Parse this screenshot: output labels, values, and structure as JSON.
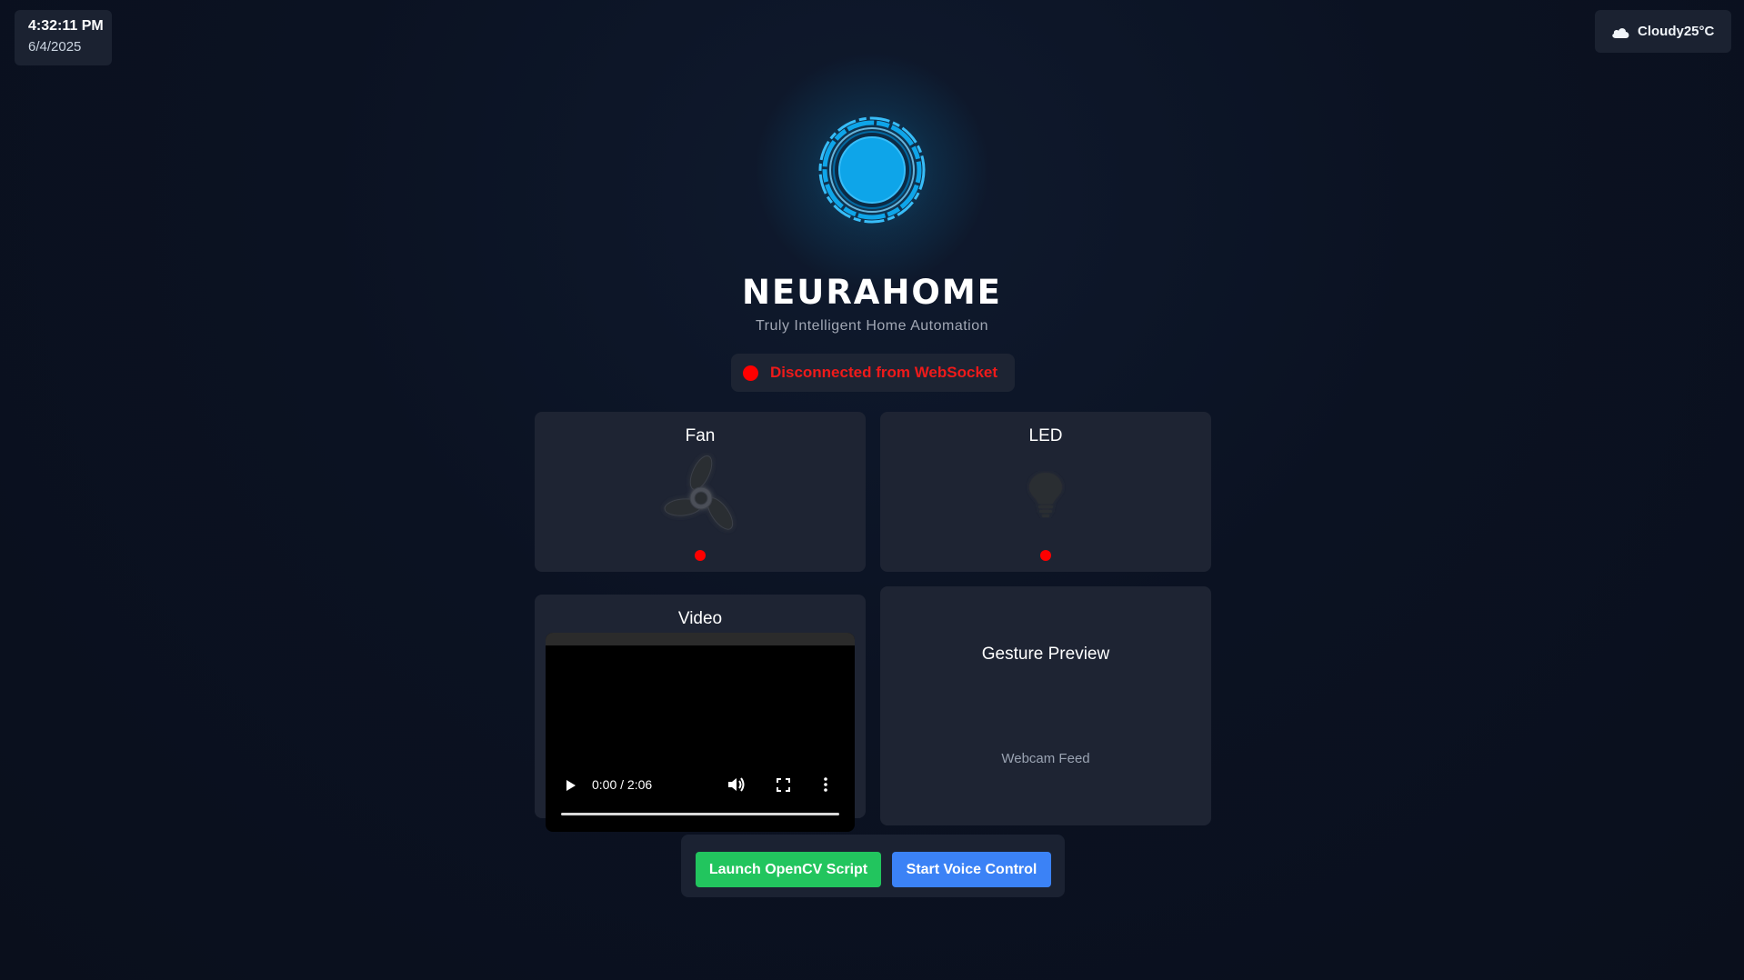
{
  "clock": {
    "time": "4:32:11 PM",
    "date": "6/4/2025"
  },
  "weather": {
    "condition": "Cloudy",
    "temperature": "25°C",
    "icon": "cloud-icon"
  },
  "hero": {
    "icon": "neural-orb-icon",
    "brand": "NEURAHOME",
    "tagline": "Truly Intelligent Home Automation"
  },
  "connection": {
    "status_text": "Disconnected from WebSocket",
    "status_color": "#ff0000"
  },
  "devices": [
    {
      "label": "Fan",
      "icon": "fan-icon",
      "state": "off",
      "indicator_color": "#ff0000"
    },
    {
      "label": "LED",
      "icon": "lightbulb-icon",
      "state": "off",
      "indicator_color": "#ff0000"
    }
  ],
  "video": {
    "label": "Video",
    "timecode": "0:00 / 2:06",
    "progress": 0
  },
  "gesture": {
    "label": "Gesture Preview",
    "feed_label": "Webcam Feed"
  },
  "actions": {
    "launch_opencv": "Launch OpenCV Script",
    "voice_control": "Start Voice Control"
  },
  "colors": {
    "accent": "#0ea5e9",
    "green": "#22c55e",
    "blue": "#3b82f6",
    "card": "#1e2433"
  }
}
